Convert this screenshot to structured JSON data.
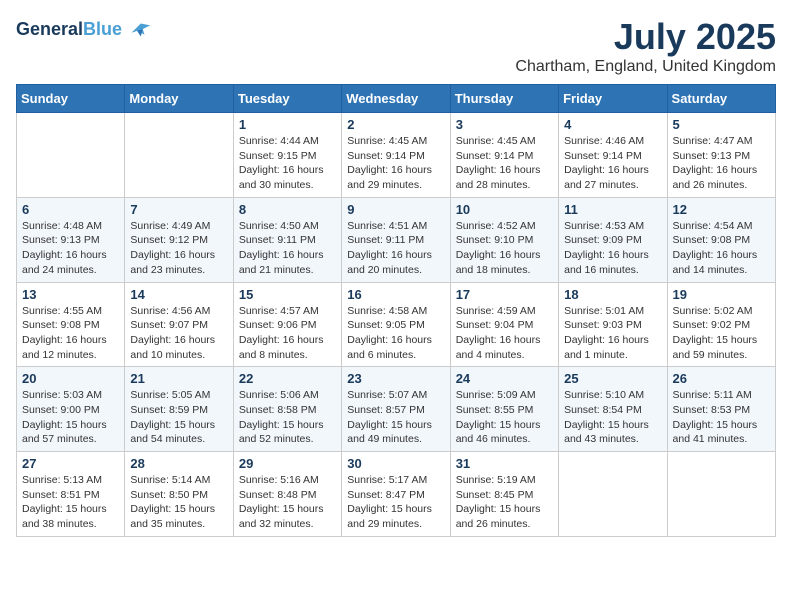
{
  "header": {
    "logo_line1": "General",
    "logo_line2": "Blue",
    "title": "July 2025",
    "subtitle": "Chartham, England, United Kingdom"
  },
  "weekdays": [
    "Sunday",
    "Monday",
    "Tuesday",
    "Wednesday",
    "Thursday",
    "Friday",
    "Saturday"
  ],
  "weeks": [
    [
      {
        "day": "",
        "sunrise": "",
        "sunset": "",
        "daylight": ""
      },
      {
        "day": "",
        "sunrise": "",
        "sunset": "",
        "daylight": ""
      },
      {
        "day": "1",
        "sunrise": "Sunrise: 4:44 AM",
        "sunset": "Sunset: 9:15 PM",
        "daylight": "Daylight: 16 hours and 30 minutes."
      },
      {
        "day": "2",
        "sunrise": "Sunrise: 4:45 AM",
        "sunset": "Sunset: 9:14 PM",
        "daylight": "Daylight: 16 hours and 29 minutes."
      },
      {
        "day": "3",
        "sunrise": "Sunrise: 4:45 AM",
        "sunset": "Sunset: 9:14 PM",
        "daylight": "Daylight: 16 hours and 28 minutes."
      },
      {
        "day": "4",
        "sunrise": "Sunrise: 4:46 AM",
        "sunset": "Sunset: 9:14 PM",
        "daylight": "Daylight: 16 hours and 27 minutes."
      },
      {
        "day": "5",
        "sunrise": "Sunrise: 4:47 AM",
        "sunset": "Sunset: 9:13 PM",
        "daylight": "Daylight: 16 hours and 26 minutes."
      }
    ],
    [
      {
        "day": "6",
        "sunrise": "Sunrise: 4:48 AM",
        "sunset": "Sunset: 9:13 PM",
        "daylight": "Daylight: 16 hours and 24 minutes."
      },
      {
        "day": "7",
        "sunrise": "Sunrise: 4:49 AM",
        "sunset": "Sunset: 9:12 PM",
        "daylight": "Daylight: 16 hours and 23 minutes."
      },
      {
        "day": "8",
        "sunrise": "Sunrise: 4:50 AM",
        "sunset": "Sunset: 9:11 PM",
        "daylight": "Daylight: 16 hours and 21 minutes."
      },
      {
        "day": "9",
        "sunrise": "Sunrise: 4:51 AM",
        "sunset": "Sunset: 9:11 PM",
        "daylight": "Daylight: 16 hours and 20 minutes."
      },
      {
        "day": "10",
        "sunrise": "Sunrise: 4:52 AM",
        "sunset": "Sunset: 9:10 PM",
        "daylight": "Daylight: 16 hours and 18 minutes."
      },
      {
        "day": "11",
        "sunrise": "Sunrise: 4:53 AM",
        "sunset": "Sunset: 9:09 PM",
        "daylight": "Daylight: 16 hours and 16 minutes."
      },
      {
        "day": "12",
        "sunrise": "Sunrise: 4:54 AM",
        "sunset": "Sunset: 9:08 PM",
        "daylight": "Daylight: 16 hours and 14 minutes."
      }
    ],
    [
      {
        "day": "13",
        "sunrise": "Sunrise: 4:55 AM",
        "sunset": "Sunset: 9:08 PM",
        "daylight": "Daylight: 16 hours and 12 minutes."
      },
      {
        "day": "14",
        "sunrise": "Sunrise: 4:56 AM",
        "sunset": "Sunset: 9:07 PM",
        "daylight": "Daylight: 16 hours and 10 minutes."
      },
      {
        "day": "15",
        "sunrise": "Sunrise: 4:57 AM",
        "sunset": "Sunset: 9:06 PM",
        "daylight": "Daylight: 16 hours and 8 minutes."
      },
      {
        "day": "16",
        "sunrise": "Sunrise: 4:58 AM",
        "sunset": "Sunset: 9:05 PM",
        "daylight": "Daylight: 16 hours and 6 minutes."
      },
      {
        "day": "17",
        "sunrise": "Sunrise: 4:59 AM",
        "sunset": "Sunset: 9:04 PM",
        "daylight": "Daylight: 16 hours and 4 minutes."
      },
      {
        "day": "18",
        "sunrise": "Sunrise: 5:01 AM",
        "sunset": "Sunset: 9:03 PM",
        "daylight": "Daylight: 16 hours and 1 minute."
      },
      {
        "day": "19",
        "sunrise": "Sunrise: 5:02 AM",
        "sunset": "Sunset: 9:02 PM",
        "daylight": "Daylight: 15 hours and 59 minutes."
      }
    ],
    [
      {
        "day": "20",
        "sunrise": "Sunrise: 5:03 AM",
        "sunset": "Sunset: 9:00 PM",
        "daylight": "Daylight: 15 hours and 57 minutes."
      },
      {
        "day": "21",
        "sunrise": "Sunrise: 5:05 AM",
        "sunset": "Sunset: 8:59 PM",
        "daylight": "Daylight: 15 hours and 54 minutes."
      },
      {
        "day": "22",
        "sunrise": "Sunrise: 5:06 AM",
        "sunset": "Sunset: 8:58 PM",
        "daylight": "Daylight: 15 hours and 52 minutes."
      },
      {
        "day": "23",
        "sunrise": "Sunrise: 5:07 AM",
        "sunset": "Sunset: 8:57 PM",
        "daylight": "Daylight: 15 hours and 49 minutes."
      },
      {
        "day": "24",
        "sunrise": "Sunrise: 5:09 AM",
        "sunset": "Sunset: 8:55 PM",
        "daylight": "Daylight: 15 hours and 46 minutes."
      },
      {
        "day": "25",
        "sunrise": "Sunrise: 5:10 AM",
        "sunset": "Sunset: 8:54 PM",
        "daylight": "Daylight: 15 hours and 43 minutes."
      },
      {
        "day": "26",
        "sunrise": "Sunrise: 5:11 AM",
        "sunset": "Sunset: 8:53 PM",
        "daylight": "Daylight: 15 hours and 41 minutes."
      }
    ],
    [
      {
        "day": "27",
        "sunrise": "Sunrise: 5:13 AM",
        "sunset": "Sunset: 8:51 PM",
        "daylight": "Daylight: 15 hours and 38 minutes."
      },
      {
        "day": "28",
        "sunrise": "Sunrise: 5:14 AM",
        "sunset": "Sunset: 8:50 PM",
        "daylight": "Daylight: 15 hours and 35 minutes."
      },
      {
        "day": "29",
        "sunrise": "Sunrise: 5:16 AM",
        "sunset": "Sunset: 8:48 PM",
        "daylight": "Daylight: 15 hours and 32 minutes."
      },
      {
        "day": "30",
        "sunrise": "Sunrise: 5:17 AM",
        "sunset": "Sunset: 8:47 PM",
        "daylight": "Daylight: 15 hours and 29 minutes."
      },
      {
        "day": "31",
        "sunrise": "Sunrise: 5:19 AM",
        "sunset": "Sunset: 8:45 PM",
        "daylight": "Daylight: 15 hours and 26 minutes."
      },
      {
        "day": "",
        "sunrise": "",
        "sunset": "",
        "daylight": ""
      },
      {
        "day": "",
        "sunrise": "",
        "sunset": "",
        "daylight": ""
      }
    ]
  ]
}
